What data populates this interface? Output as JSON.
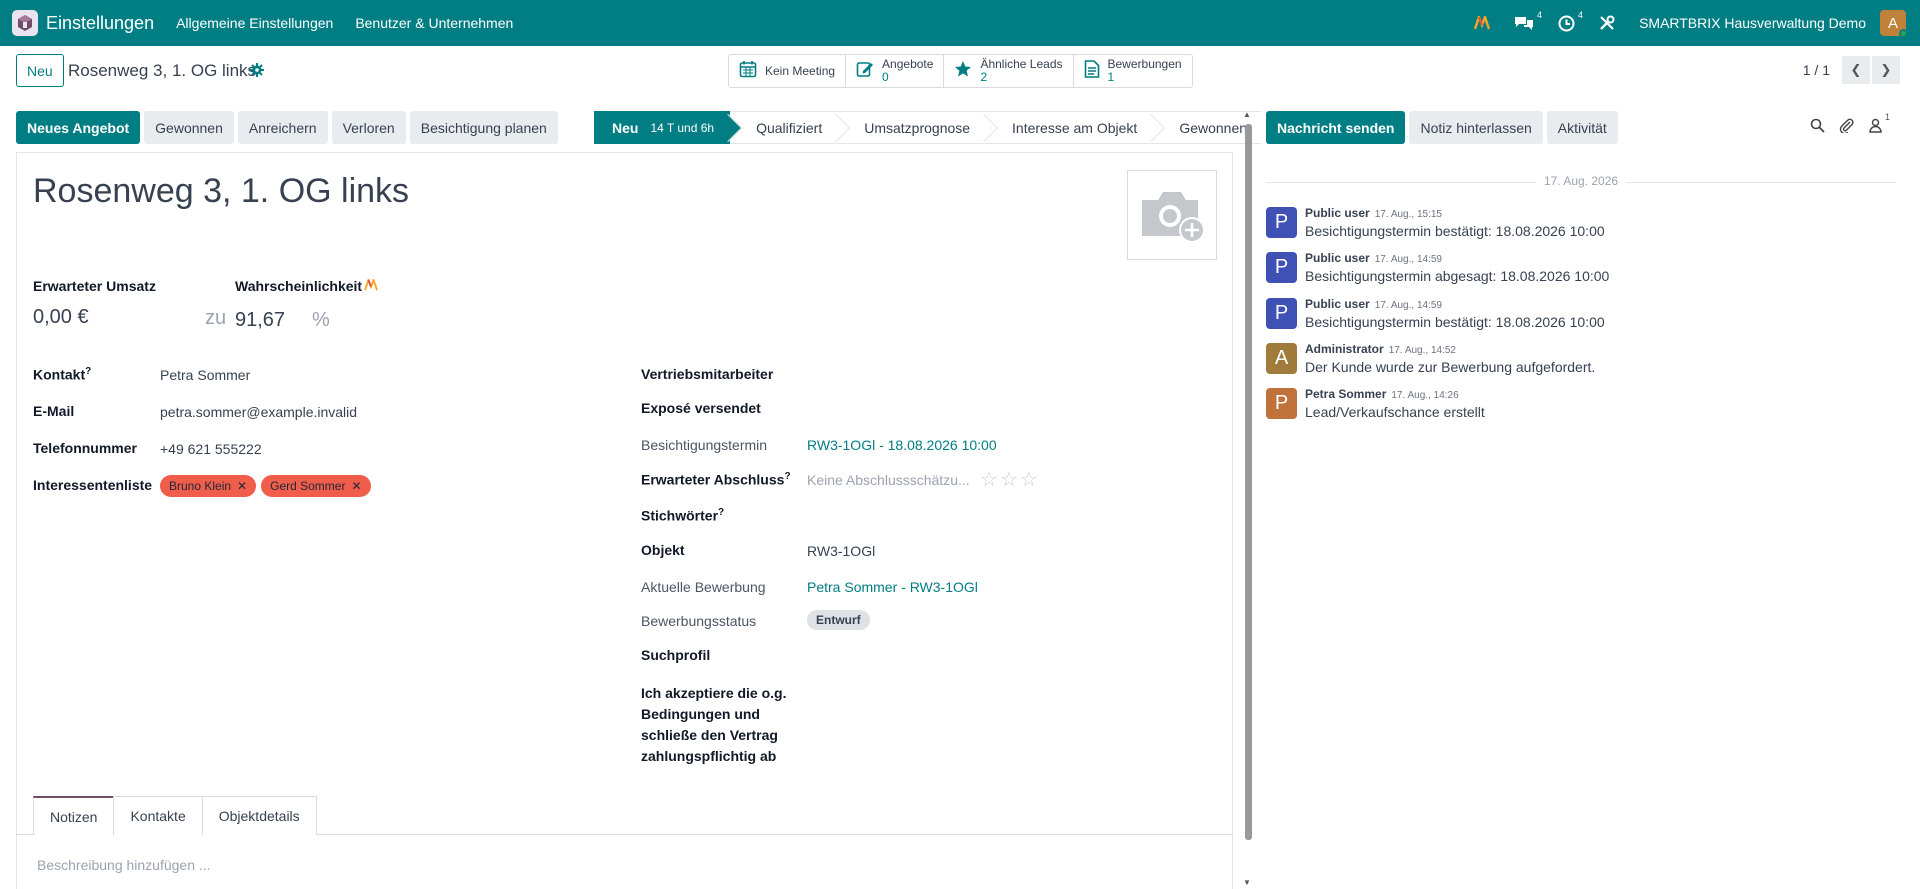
{
  "topbar": {
    "app_name": "Einstellungen",
    "menu": [
      "Allgemeine Einstellungen",
      "Benutzer & Unternehmen"
    ],
    "chat_count": "4",
    "activity_count": "4",
    "company": "SMARTBRIX Hausverwaltung Demo",
    "user_initial": "A"
  },
  "control_panel": {
    "new_label": "Neu",
    "record_name": "Rosenweg 3, 1. OG links",
    "smart_buttons": {
      "meeting": "Kein Meeting",
      "offers_label": "Angebote",
      "offers_count": "0",
      "similar_label": "Ähnliche Leads",
      "similar_count": "2",
      "applications_label": "Bewerbungen",
      "applications_count": "1"
    },
    "pager": "1 / 1"
  },
  "actions": [
    "Neues Angebot",
    "Gewonnen",
    "Anreichern",
    "Verloren",
    "Besichtigung planen"
  ],
  "stages": {
    "current": "Neu",
    "current_duration": "14 T und 6h",
    "others": [
      "Qualifiziert",
      "Umsatzprognose",
      "Interesse am Objekt",
      "Gewonnen"
    ]
  },
  "form": {
    "title": "Rosenweg 3, 1. OG links",
    "expected_revenue_label": "Erwarteter Umsatz",
    "expected_revenue": "0,00 €",
    "probability_label": "Wahrscheinlichkeit",
    "zu": "zu",
    "probability": "91,67",
    "percent": "%",
    "contact_label": "Kontakt",
    "contact": "Petra Sommer",
    "email_label": "E-Mail",
    "email": "petra.sommer@example.invalid",
    "phone_label": "Telefonnummer",
    "phone": "+49 621 555222",
    "interest_label": "Interessentenliste",
    "interest_tags": [
      "Bruno Klein",
      "Gerd Sommer"
    ],
    "salesperson_label": "Vertriebsmitarbeiter",
    "expose_label": "Exposé versendet",
    "viewing_label": "Besichtigungstermin",
    "viewing": "RW3-1OGl - 18.08.2026 10:00",
    "closing_label": "Erwarteter Abschluss",
    "closing_placeholder": "Keine Abschlussschätzu...",
    "keywords_label": "Stichwörter",
    "object_label": "Objekt",
    "object": "RW3-1OGl",
    "application_label": "Aktuelle Bewerbung",
    "application": "Petra Sommer - RW3-1OGl",
    "application_status_label": "Bewerbungsstatus",
    "application_status": "Entwurf",
    "search_profile_label": "Suchprofil",
    "accept_label_lines": [
      "Ich akzeptiere die o.g.",
      "Bedingungen und",
      "schließe den Vertrag",
      "zahlungspflichtig ab"
    ],
    "tabs": [
      "Notizen",
      "Kontakte",
      "Objektdetails"
    ],
    "description_placeholder": "Beschreibung hinzufügen ..."
  },
  "chatter": {
    "send_message": "Nachricht senden",
    "log_note": "Notiz hinterlassen",
    "activity": "Aktivität",
    "follower_count": "1",
    "date_separator": "17. Aug. 2026",
    "messages": [
      {
        "initial": "P",
        "color": "#3f51b5",
        "author": "Public user",
        "time": "17. Aug., 15:15",
        "body": "Besichtigungstermin bestätigt: 18.08.2026 10:00"
      },
      {
        "initial": "P",
        "color": "#3f51b5",
        "author": "Public user",
        "time": "17. Aug., 14:59",
        "body": "Besichtigungstermin abgesagt: 18.08.2026 10:00"
      },
      {
        "initial": "P",
        "color": "#3f51b5",
        "author": "Public user",
        "time": "17. Aug., 14:59",
        "body": "Besichtigungstermin bestätigt: 18.08.2026 10:00"
      },
      {
        "initial": "A",
        "color": "#a07b3c",
        "author": "Administrator",
        "time": "17. Aug., 14:52",
        "body": "Der Kunde wurde zur Bewerbung aufgefordert."
      },
      {
        "initial": "P",
        "color": "#c0723a",
        "author": "Petra Sommer",
        "time": "17. Aug., 14:26",
        "body": "Lead/Verkaufschance erstellt"
      }
    ]
  },
  "colors": {
    "brand": "#017e84",
    "tag": "#f05d4a",
    "accent": "#714b67"
  }
}
